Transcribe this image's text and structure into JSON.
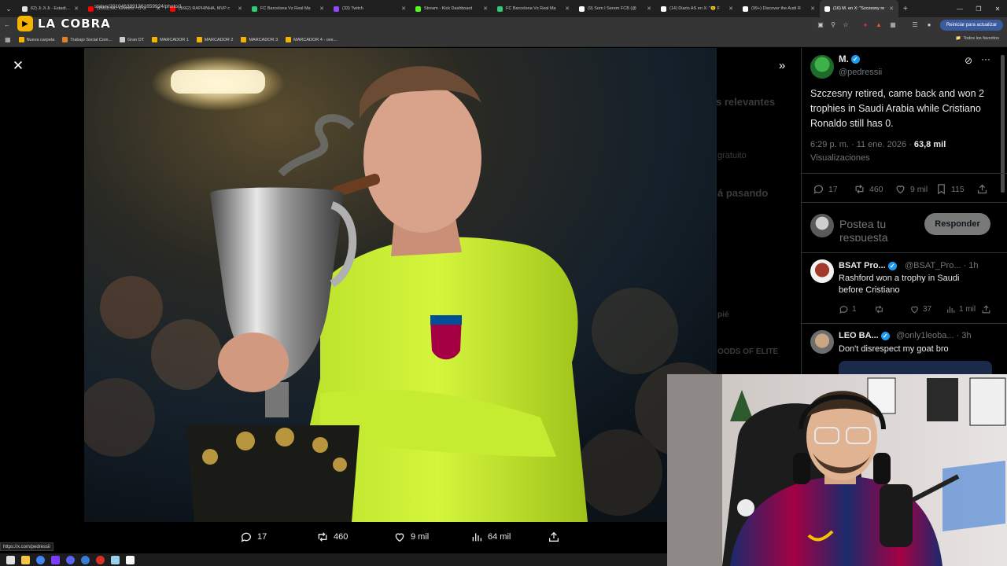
{
  "browser": {
    "tabs": [
      {
        "title": "62) Ji Ji Ji - Estadio Úni",
        "color": "#e0e0e0"
      },
      {
        "title": "(1663) MC Kevinho - O G",
        "color": "#ff0000"
      },
      {
        "title": "(1662) RAPHINHA, MVP c",
        "color": "#ff0000"
      },
      {
        "title": "FC Barcelona Vs Real Ma",
        "color": "#2ecc71"
      },
      {
        "title": "(33) Twitch",
        "color": "#9146ff"
      },
      {
        "title": "Stream - Kick Dashboard",
        "color": "#53fc18"
      },
      {
        "title": "FC Barcelona Vs Real Ma",
        "color": "#2ecc71"
      },
      {
        "title": "(9) Som I Serem FCB (@",
        "color": "#ffffff"
      },
      {
        "title": "(14) Diario AS en X: \"😮 F",
        "color": "#ffffff"
      },
      {
        "title": "(99+) Discover the Audi R",
        "color": "#ffffff"
      },
      {
        "title": "(16) M. en X: \"Szczesny re",
        "color": "#ffffff",
        "active": true
      }
    ],
    "url": "status/2010463991361859924/photo/1",
    "restart_label": "Reiniciar para actualizar",
    "bookmarks": [
      {
        "label": "Nueva carpeta",
        "color": "#f5b301"
      },
      {
        "label": "Trabajo Social Com...",
        "color": "#e67e22"
      },
      {
        "label": "Gran DT",
        "color": "#cccccc"
      },
      {
        "label": "MARCADOR 1",
        "color": "#f5b301"
      },
      {
        "label": "MARCADOR 2",
        "color": "#f5b301"
      },
      {
        "label": "MARCADOR 3",
        "color": "#f5b301"
      },
      {
        "label": "MARCADOR 4 - ove...",
        "color": "#f5b301"
      }
    ],
    "all_favorites": "Todos los favoritos",
    "status_link": "https://x.com/pedressii"
  },
  "overlay_logo": "LA COBRA",
  "viewer": {
    "actions": {
      "replies": "17",
      "reposts": "460",
      "likes": "9 mil",
      "views": "64 mil"
    }
  },
  "ghost_text": {
    "relevant": "s relevantes",
    "gratis": "gratuito",
    "pasando": "á pasando",
    "pie": "pié",
    "goods": "OODS OF ELITE"
  },
  "tweet": {
    "author_name": "M.",
    "author_handle": "@pedressii",
    "text": "Szczesny retired, came back and won 2 trophies in Saudi Arabia while Cristiano Ronaldo still has 0.",
    "timestamp": "6:29 p. m. · 11 ene. 2026 · ",
    "views_count": "63,8 mil",
    "views_label": "Visualizaciones",
    "stats": {
      "replies": "17",
      "reposts": "460",
      "likes": "9 mil",
      "bookmarks": "115"
    },
    "reply_placeholder": "Postea tu respuesta",
    "reply_button": "Responder"
  },
  "replies": [
    {
      "name": "BSAT Pro...",
      "handle": "@BSAT_Pro... · 1h",
      "text": "Rashford won a trophy in Saudi before Cristiano",
      "replies": "1",
      "reposts": "",
      "likes": "37",
      "views": "1 mil"
    },
    {
      "name": "LEO BA...",
      "handle": "@only1leoba... · 3h",
      "text": "Don't disrespect my goat bro"
    }
  ]
}
